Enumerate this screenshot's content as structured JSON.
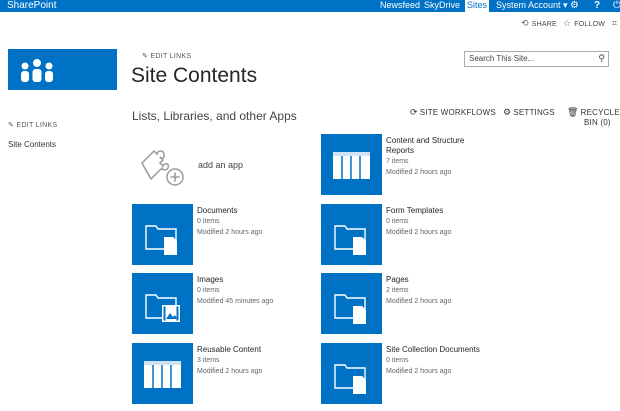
{
  "suite_bar": {
    "brand": "SharePoint",
    "nav": [
      "Newsfeed",
      "SkyDrive",
      "Sites"
    ],
    "account": "System Account",
    "icons": [
      "gear-icon",
      "help-icon",
      "power-icon"
    ]
  },
  "actions_row": {
    "share": "SHARE",
    "follow": "FOLLOW"
  },
  "header": {
    "edit_links": "EDIT LINKS",
    "page_title": "Site Contents",
    "search_placeholder": "Search This Site..."
  },
  "left_nav": {
    "edit_links": "EDIT LINKS",
    "items": [
      "Site Contents"
    ]
  },
  "main": {
    "section_heading": "Lists, Libraries, and other Apps",
    "actions": {
      "site_workflows": "SITE WORKFLOWS",
      "settings": "SETTINGS",
      "recycle_bin_line1": "RECYCLE",
      "recycle_bin_line2": "BIN (0)"
    },
    "add_app": "add an app",
    "apps": [
      {
        "title": "Content and Structure Reports",
        "title_line1": "Content and Structure",
        "title_line2": "Reports",
        "items": "7 items",
        "modified": "Modified 2 hours ago",
        "icon": "list-icon"
      },
      {
        "title": "Documents",
        "items": "0 items",
        "modified": "Modified 2 hours ago",
        "icon": "document-library-icon"
      },
      {
        "title": "Form Templates",
        "items": "0 items",
        "modified": "Modified 2 hours ago",
        "icon": "document-library-icon"
      },
      {
        "title": "Images",
        "items": "0 items",
        "modified": "Modified 45 minutes ago",
        "icon": "image-library-icon"
      },
      {
        "title": "Pages",
        "items": "2 items",
        "modified": "Modified 2 hours ago",
        "icon": "document-library-icon"
      },
      {
        "title": "Reusable Content",
        "items": "3 items",
        "modified": "Modified 2 hours ago",
        "icon": "list-icon"
      },
      {
        "title": "Site Collection Documents",
        "items": "0 items",
        "modified": "Modified 2 hours ago",
        "icon": "document-library-icon"
      }
    ]
  },
  "colors": {
    "brand_blue": "#0072c6",
    "text": "#444444"
  }
}
